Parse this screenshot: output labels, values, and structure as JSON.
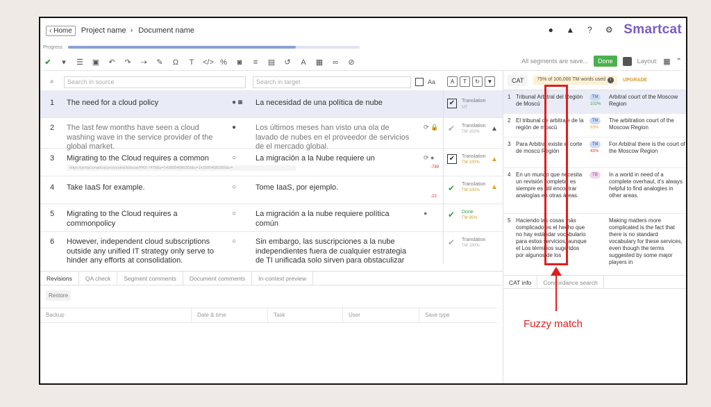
{
  "header": {
    "home_label": "Home",
    "project_name": "Project name",
    "separator": "›",
    "document_name": "Document name",
    "brand": "Smartcat",
    "icons": [
      "chat-icon",
      "bell-icon",
      "help-icon",
      "gear-icon"
    ]
  },
  "progress": {
    "label": "Progress",
    "value": 0.78
  },
  "toolbar": {
    "icons": [
      "check-icon",
      "caret-icon",
      "list-icon",
      "preview-icon",
      "undo-icon",
      "redo-icon",
      "arrow-icon",
      "brush-icon",
      "omega-icon",
      "text-size-icon",
      "code-icon",
      "percent-icon",
      "camera-icon",
      "lines-icon",
      "doc-icon",
      "history-icon",
      "spell-icon",
      "glossary-icon",
      "link-icon",
      "unlink-icon"
    ],
    "saved_text": "All segments are save...",
    "done_label": "Done",
    "layout_label": "Layout:"
  },
  "search": {
    "source_placeholder": "Search in source",
    "target_placeholder": "Search in target",
    "aa_label": "Aa"
  },
  "segments": [
    {
      "num": "1",
      "source": "The need for a cloud policy",
      "target": "La necesidad de una política de nube",
      "status": "Translation",
      "status_sub": "MT",
      "checked": true
    },
    {
      "num": "2",
      "source": "The last few months have seen a cloud washing wave in the service provider of  the global market.",
      "target": "Los últimos meses han visto una ola de lavado de nubes en el proveedor de servicios de el mercado global.",
      "status": "Translation",
      "status_sub": "TM 102%",
      "checked": false
    },
    {
      "num": "3",
      "source": "Migrating to the Cloud requires a common",
      "target": "La migración a la Nube requiere un",
      "status": "Translation",
      "status_sub": "TM 100%",
      "checked": true,
      "url": "https://portal.smartcat.pro/youtrack/issue/PRX-7478&u=1428954680366&u=1428954680366&u=",
      "delta": "-789"
    },
    {
      "num": "4",
      "source": "Take IaaS for example.",
      "target": "Tome IaaS, por ejemplo.",
      "status": "Translation",
      "status_sub": "TM 100%",
      "checked": false,
      "delta": "-23"
    },
    {
      "num": "5",
      "source": "Migrating to the Cloud requires a commonpolicy",
      "target": "La migración a la nube requiere política común",
      "status": "Done",
      "status_sub": "TM 95%",
      "checked": false
    },
    {
      "num": "6",
      "source": "However, independent cloud subscriptions outside any unified IT strategy only serve to hinder any efforts at consolidation.",
      "target": "Sin embargo, las suscripciones a la nube independientes fuera de cualquier estrategia de TI unificada solo sirven para obstaculizar cualquier esfuerzo de consolidación.",
      "status": "Translation",
      "status_sub": "TM 100%",
      "checked": false
    }
  ],
  "bottom_panel": {
    "tabs": [
      "Revisions",
      "QA check",
      "Segment comments",
      "Document comments",
      "In-context preview"
    ],
    "restore_label": "Restore",
    "columns": [
      "Backup",
      "Date & time",
      "Task",
      "User",
      "Save type"
    ]
  },
  "cat": {
    "tab_label": "CAT",
    "tm_used": "75% of 100,000 TM words used",
    "upgrade": "UPGRADE",
    "rows": [
      {
        "num": "1",
        "source": "Tribunal Arbitral del Región de Moscú",
        "badge": "TM",
        "pct": "102%",
        "target": "Arbitral court of the Moscow Region"
      },
      {
        "num": "2",
        "source": "El tribunal de arbitraje de la región de moscú",
        "badge": "TM",
        "pct": "93%",
        "target": "The arbitration court of the Moscow Region"
      },
      {
        "num": "3",
        "source": "Para Arbitral existe el corte de moscú Región",
        "badge": "TM",
        "pct": "43%",
        "target": "For Arbitral there is the court of the Moscow Region"
      },
      {
        "num": "4",
        "source": "En un mundo que necesita un revisión completa, es siempre es útil encontrar analogías en otras áreas.",
        "badge": "TB",
        "pct": "",
        "target": "In a world in need of a complete overhaul, it's always helpful to find analogies in other areas."
      },
      {
        "num": "5",
        "source": "Haciendo las cosas más complicado es el hecho que no hay estándar vocabulario para estos servicios, aunque el Los términos sugeridos por algunos de los",
        "badge": "",
        "pct": "",
        "target": "Making matters more complicated is the fact that there is no standard vocabulary for these services, even though the terms suggested by some major players in"
      }
    ],
    "info_tabs": [
      "CAT info",
      "Concordance search"
    ]
  },
  "annotation": {
    "label": "Fuzzy match",
    "color": "#e01e1e"
  }
}
